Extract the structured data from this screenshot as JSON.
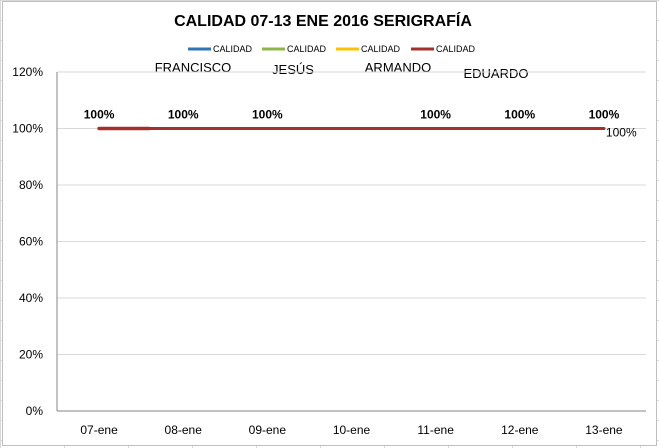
{
  "chart_data": {
    "type": "line",
    "title": "CALIDAD 07-13 ENE 2016 SERIGRAFÍA",
    "categories": [
      "07-ene",
      "08-ene",
      "09-ene",
      "10-ene",
      "11-ene",
      "12-ene",
      "13-ene"
    ],
    "ylim": [
      0,
      1.2
    ],
    "yticks": [
      "0%",
      "20%",
      "40%",
      "60%",
      "80%",
      "100%",
      "120%"
    ],
    "ytick_values": [
      0,
      0.2,
      0.4,
      0.6,
      0.8,
      1.0,
      1.2
    ],
    "grid": true,
    "legend_position": "top",
    "series": [
      {
        "name": "CALIDAD",
        "label": "FRANCISCO",
        "color": "#2e75b6",
        "values": [
          1,
          1,
          1,
          1,
          1,
          1,
          1
        ]
      },
      {
        "name": "CALIDAD",
        "label": "JESÚS",
        "color": "#8db548",
        "values": [
          1,
          1,
          1,
          1,
          1,
          1,
          1
        ]
      },
      {
        "name": "CALIDAD",
        "label": "ARMANDO",
        "color": "#ffc000",
        "values": [
          1,
          1,
          1,
          1,
          1,
          1,
          1
        ]
      },
      {
        "name": "CALIDAD",
        "label": "EDUARDO",
        "color": "#a5302b",
        "values": [
          1,
          1,
          1,
          1,
          1,
          1,
          1
        ]
      }
    ],
    "data_labels": [
      {
        "category": "07-ene",
        "text": "100%"
      },
      {
        "category": "08-ene",
        "text": "100%"
      },
      {
        "category": "09-ene",
        "text": "100%"
      },
      {
        "category": "11-ene",
        "text": "100%"
      },
      {
        "category": "12-ene",
        "text": "100%"
      },
      {
        "category": "13-ene",
        "text": "100%"
      }
    ],
    "extra_label": {
      "category": "13-ene",
      "text": "100%"
    }
  }
}
